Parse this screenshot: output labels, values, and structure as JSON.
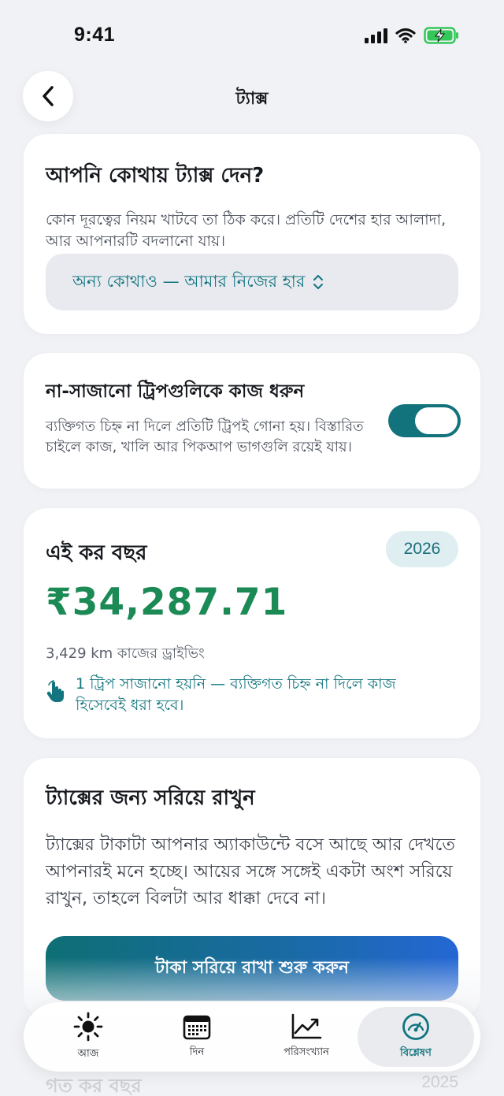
{
  "status_bar": {
    "time": "9:41"
  },
  "header": {
    "title": "ট্যাক্স"
  },
  "location_card": {
    "title": "আপনি কোথায় ট্যাক্স দেন?",
    "description": "কোন দূরত্বের নিয়ম খাটবে তা ঠিক করে। প্রতিটি দেশের হার আলাদা, আর আপনারটি বদলানো যায়।",
    "selected_option": "অন্য কোথাও — আমার নিজের হার"
  },
  "trips_card": {
    "title": "না-সাজানো ট্রিপগুলিকে কাজ ধরুন",
    "description": "ব্যক্তিগত চিহ্ন না দিলে প্রতিটি ট্রিপই গোনা হয়। বিস্তারিত চাইলে কাজ, খালি আর পিকআপ ভাগগুলি রয়েই যায়।",
    "toggle_on": true
  },
  "year_card": {
    "title": "এই কর বছর",
    "year": "2026",
    "amount": "₹34,287.71",
    "driving": "3,429 km কাজের ড্রাইভিং",
    "note": "1 ট্রিপ সাজানো হয়নি — ব্যক্তিগত চিহ্ন না দিলে কাজ হিসেবেই ধরা হবে।"
  },
  "setaside_card": {
    "title": "ট্যাক্সের জন্য সরিয়ে রাখুন",
    "description": "ট্যাক্সের টাকাটা আপনার অ্যাকাউন্টে বসে আছে আর দেখতে আপনারই মনে হচ্ছে। আয়ের সঙ্গে সঙ্গেই একটা অংশ সরিয়ে রাখুন, তাহলে বিলটা আর ধাক্কা দেবে না।",
    "button_label": "টাকা সরিয়ে রাখা শুরু করুন"
  },
  "previous_year": {
    "title": "গত কর বছর",
    "year": "2025"
  },
  "tab_bar": {
    "tabs": [
      {
        "label": "আজ",
        "icon": "sun-icon"
      },
      {
        "label": "দিন",
        "icon": "calendar-icon"
      },
      {
        "label": "পরিসংখ্যান",
        "icon": "chart-icon"
      },
      {
        "label": "বিশ্লেষণ",
        "icon": "gauge-icon"
      }
    ],
    "active_index": 3
  },
  "colors": {
    "accent_teal": "#12757f",
    "amount_green": "#1c8a55",
    "battery_green": "#34c759",
    "button_gradient": [
      "#0e6f74",
      "#2467d4"
    ]
  }
}
